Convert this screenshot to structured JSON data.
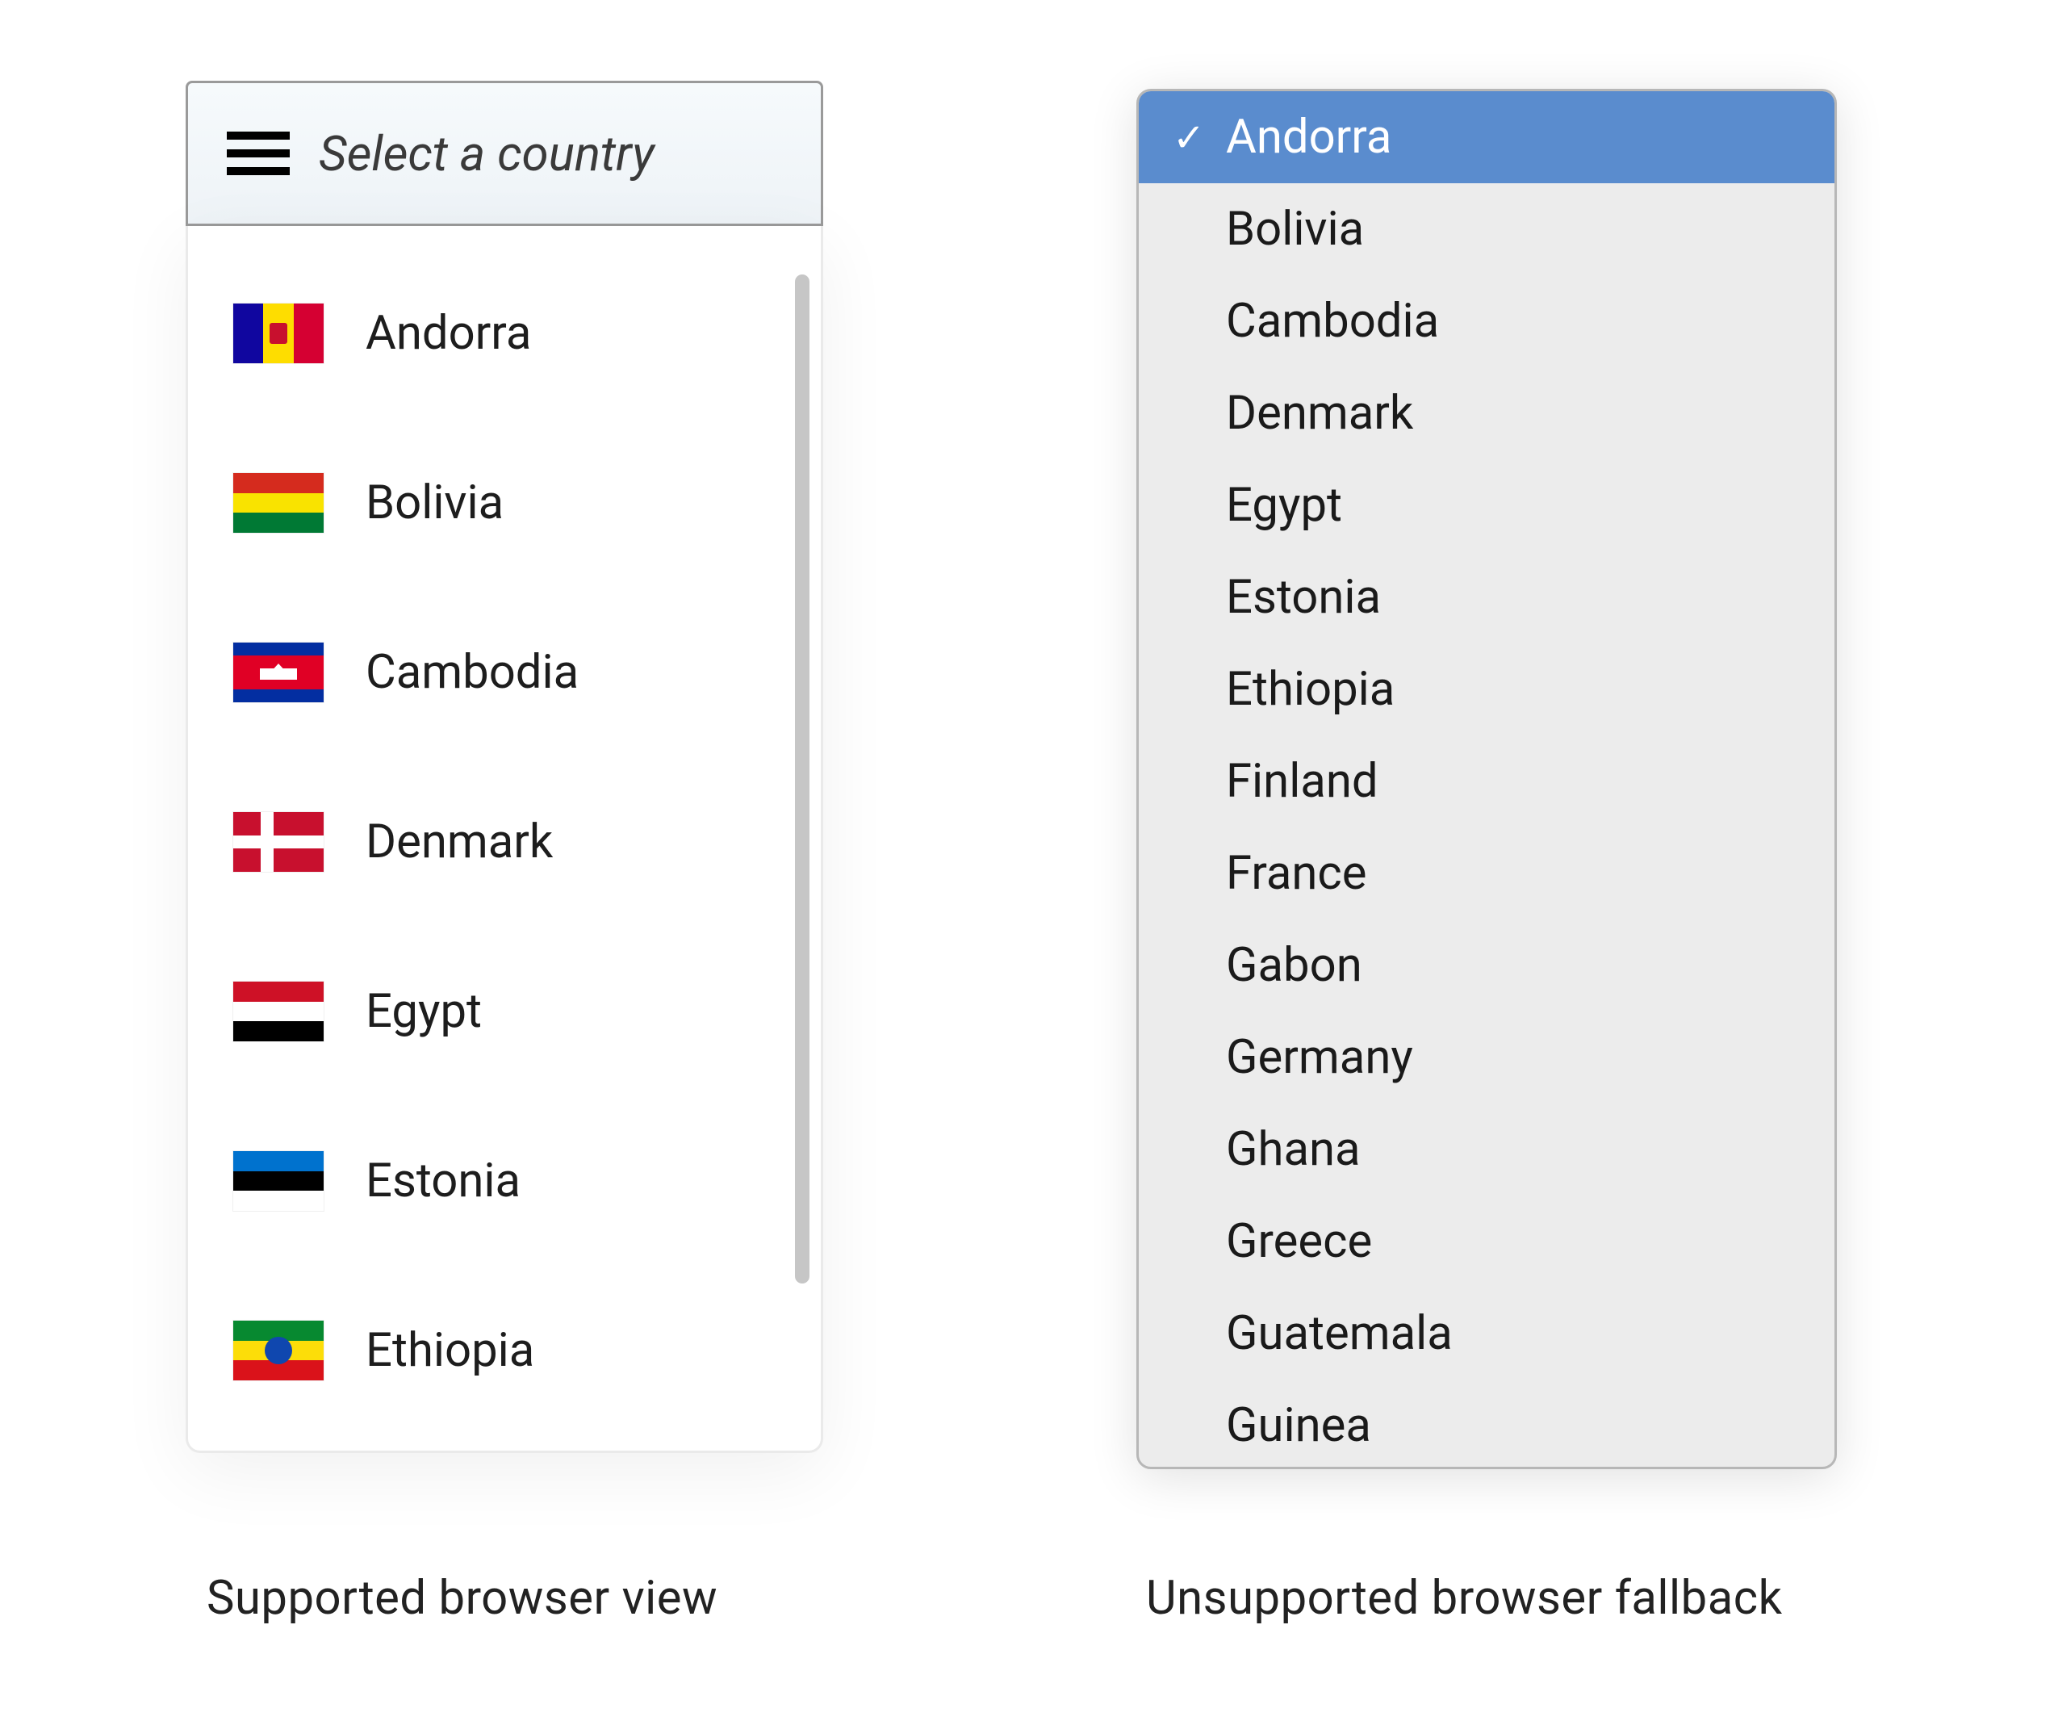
{
  "custom_select": {
    "placeholder": "Select a country",
    "options": [
      {
        "code": "ad",
        "name": "Andorra"
      },
      {
        "code": "bo",
        "name": "Bolivia"
      },
      {
        "code": "kh",
        "name": "Cambodia"
      },
      {
        "code": "dk",
        "name": "Denmark"
      },
      {
        "code": "eg",
        "name": "Egypt"
      },
      {
        "code": "ee",
        "name": "Estonia"
      },
      {
        "code": "et",
        "name": "Ethiopia"
      }
    ]
  },
  "native_select": {
    "selected": "Andorra",
    "options": [
      "Andorra",
      "Bolivia",
      "Cambodia",
      "Denmark",
      "Egypt",
      "Estonia",
      "Ethiopia",
      "Finland",
      "France",
      "Gabon",
      "Germany",
      "Ghana",
      "Greece",
      "Guatemala",
      "Guinea"
    ]
  },
  "captions": {
    "left": "Supported browser view",
    "right": "Unsupported browser fallback"
  }
}
